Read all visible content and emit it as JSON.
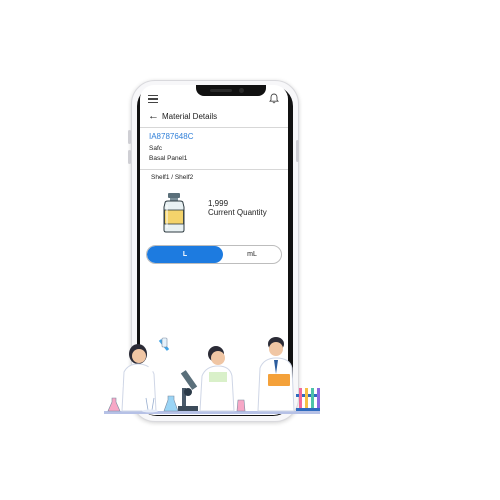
{
  "header": {
    "title": "Material Details"
  },
  "material": {
    "id": "IA8787648C",
    "line1": "Safc",
    "line2": "Basal Panel1"
  },
  "location": "Shelf1 / Shelf2",
  "quantity": {
    "value": "1,999",
    "label": "Current Quantity"
  },
  "unit_toggle": {
    "options": [
      "L",
      "mL"
    ],
    "selected": "L"
  },
  "icons": {
    "menu": "hamburger-icon",
    "notification": "bell-icon",
    "back": "back-arrow-icon",
    "product": "bottle-icon"
  },
  "colors": {
    "accent": "#1d7be0",
    "link": "#2f7fd8",
    "jar_fill": "#f4d36b",
    "jar_cap": "#5a6f7a"
  }
}
